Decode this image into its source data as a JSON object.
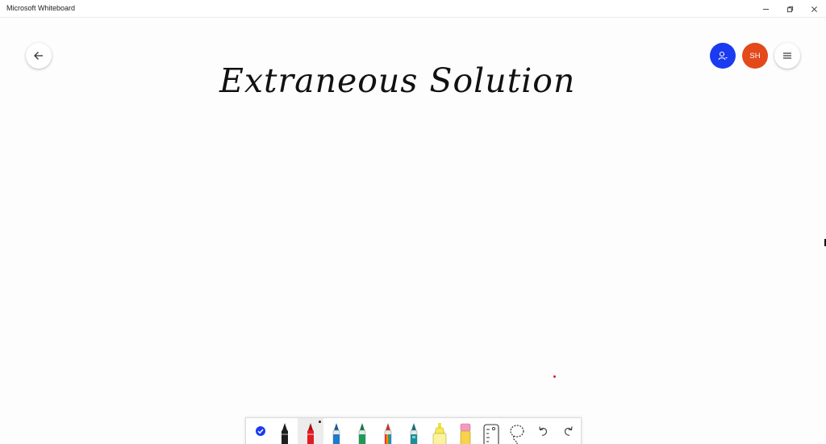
{
  "window": {
    "title": "Microsoft Whiteboard"
  },
  "header": {
    "avatar_initials": "SH"
  },
  "board": {
    "title": "Extraneous Solution"
  },
  "colors": {
    "share_button": "#1a3bf0",
    "avatar": "#e3491a",
    "stroke_dot": "#e01c22",
    "select_check": "#1a3bf0"
  },
  "toolbar": {
    "tools": [
      {
        "name": "select-toggle",
        "icon": "checkmark-icon"
      },
      {
        "name": "pen-black",
        "color": "#1e1e1e"
      },
      {
        "name": "pen-red",
        "color": "#e01c22",
        "selected": true
      },
      {
        "name": "pen-blue",
        "color": "#1f7ac9"
      },
      {
        "name": "pen-green",
        "color": "#1c9a5a"
      },
      {
        "name": "pen-rainbow",
        "color": "#e8801f"
      },
      {
        "name": "pen-galaxy",
        "color": "#1b8e97"
      },
      {
        "name": "highlighter",
        "color": "#f7ea55"
      },
      {
        "name": "eraser",
        "color": "#f49ac1"
      },
      {
        "name": "ruler",
        "icon": "ruler-icon"
      },
      {
        "name": "lasso",
        "icon": "lasso-icon"
      },
      {
        "name": "undo",
        "icon": "undo-icon"
      },
      {
        "name": "redo",
        "icon": "redo-icon"
      }
    ]
  }
}
